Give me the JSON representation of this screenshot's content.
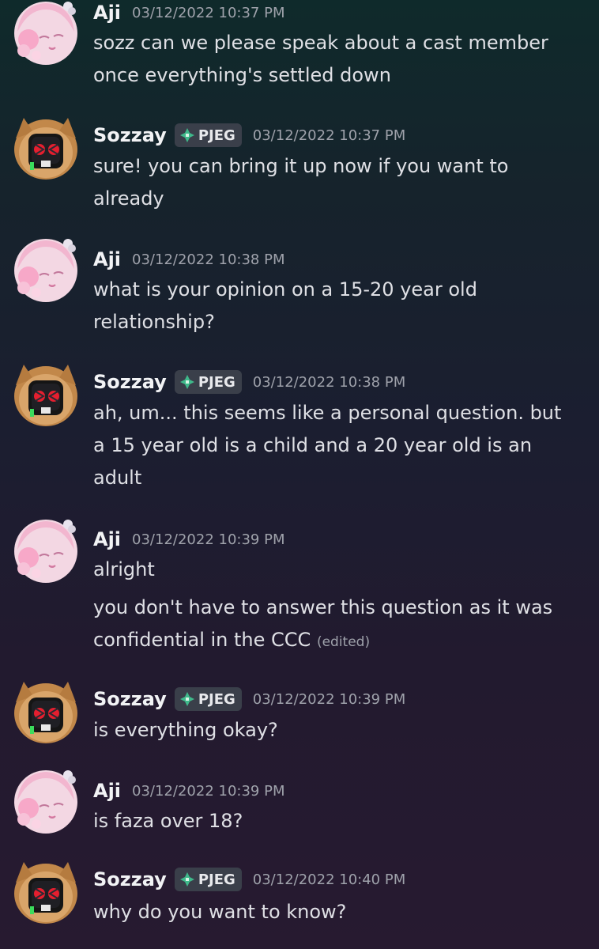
{
  "messages": [
    {
      "author": "Aji",
      "avatar": "pink-anime-avatar",
      "timestamp": "03/12/2022 10:37 PM",
      "lines": [
        "sozz can we please speak about a cast member",
        "once everything's settled down"
      ]
    },
    {
      "author": "Sozzay",
      "avatar": "lion-robot-avatar",
      "tag": "PJEG",
      "timestamp": "03/12/2022 10:37 PM",
      "lines": [
        "sure! you can bring it up now if you want to",
        "already"
      ]
    },
    {
      "author": "Aji",
      "avatar": "pink-anime-avatar",
      "timestamp": "03/12/2022 10:38 PM",
      "lines": [
        "what is your opinion on a 15-20 year old",
        "relationship?"
      ]
    },
    {
      "author": "Sozzay",
      "avatar": "lion-robot-avatar",
      "tag": "PJEG",
      "timestamp": "03/12/2022 10:38 PM",
      "lines": [
        "ah, um... this seems like a personal question. but",
        "a 15 year old is a child and a 20 year old is an",
        "adult"
      ]
    },
    {
      "author": "Aji",
      "avatar": "pink-anime-avatar",
      "timestamp": "03/12/2022 10:39 PM",
      "lines": [
        "alright"
      ],
      "followup_lines": [
        "you don't have to answer this question as it was",
        "confidential in the CCC"
      ],
      "edited": "(edited)"
    },
    {
      "author": "Sozzay",
      "avatar": "lion-robot-avatar",
      "tag": "PJEG",
      "timestamp": "03/12/2022 10:39 PM",
      "lines": [
        "is everything okay?"
      ]
    },
    {
      "author": "Aji",
      "avatar": "pink-anime-avatar",
      "timestamp": "03/12/2022 10:39 PM",
      "lines": [
        "is faza over 18?"
      ]
    },
    {
      "author": "Sozzay",
      "avatar": "lion-robot-avatar",
      "tag": "PJEG",
      "timestamp": "03/12/2022 10:40 PM",
      "lines": [
        "why do you want to know?"
      ]
    }
  ],
  "colors": {
    "username": "#f2f3f5",
    "timestamp": "#9fa2ab",
    "text": "#dfe0e5",
    "tag_bg": "#3a3f4a",
    "tag_icon": "#3fb98b"
  }
}
